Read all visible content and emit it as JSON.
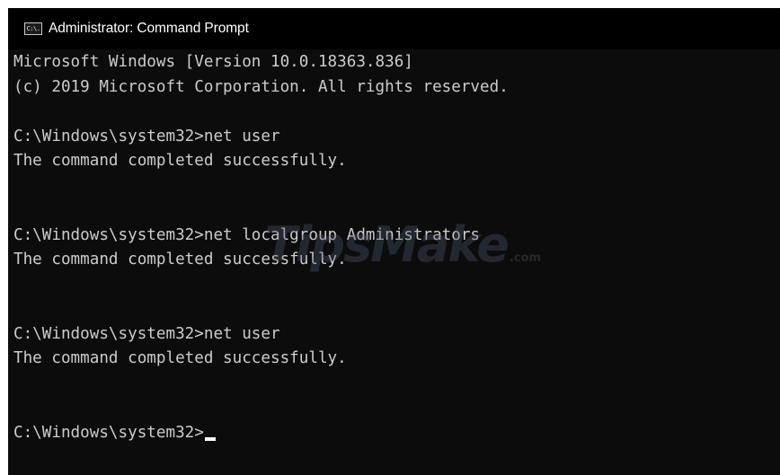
{
  "window": {
    "title": "Administrator: Command Prompt",
    "icon": "command-prompt-icon",
    "icon_text": "C:\\."
  },
  "console": {
    "lines": [
      "Microsoft Windows [Version 10.0.18363.836]",
      "(c) 2019 Microsoft Corporation. All rights reserved.",
      "",
      "C:\\Windows\\system32>net user",
      "The command completed successfully.",
      "",
      "",
      "C:\\Windows\\system32>net localgroup Administrators",
      "The command completed successfully.",
      "",
      "",
      "C:\\Windows\\system32>net user",
      "The command completed successfully.",
      "",
      "",
      "C:\\Windows\\system32>"
    ]
  },
  "watermark": {
    "text": "TipsMake",
    "suffix": ".com"
  },
  "colors": {
    "background": "#0c0c0c",
    "titlebar": "#000000",
    "text": "#cccccc",
    "cursor": "#ffffff"
  }
}
